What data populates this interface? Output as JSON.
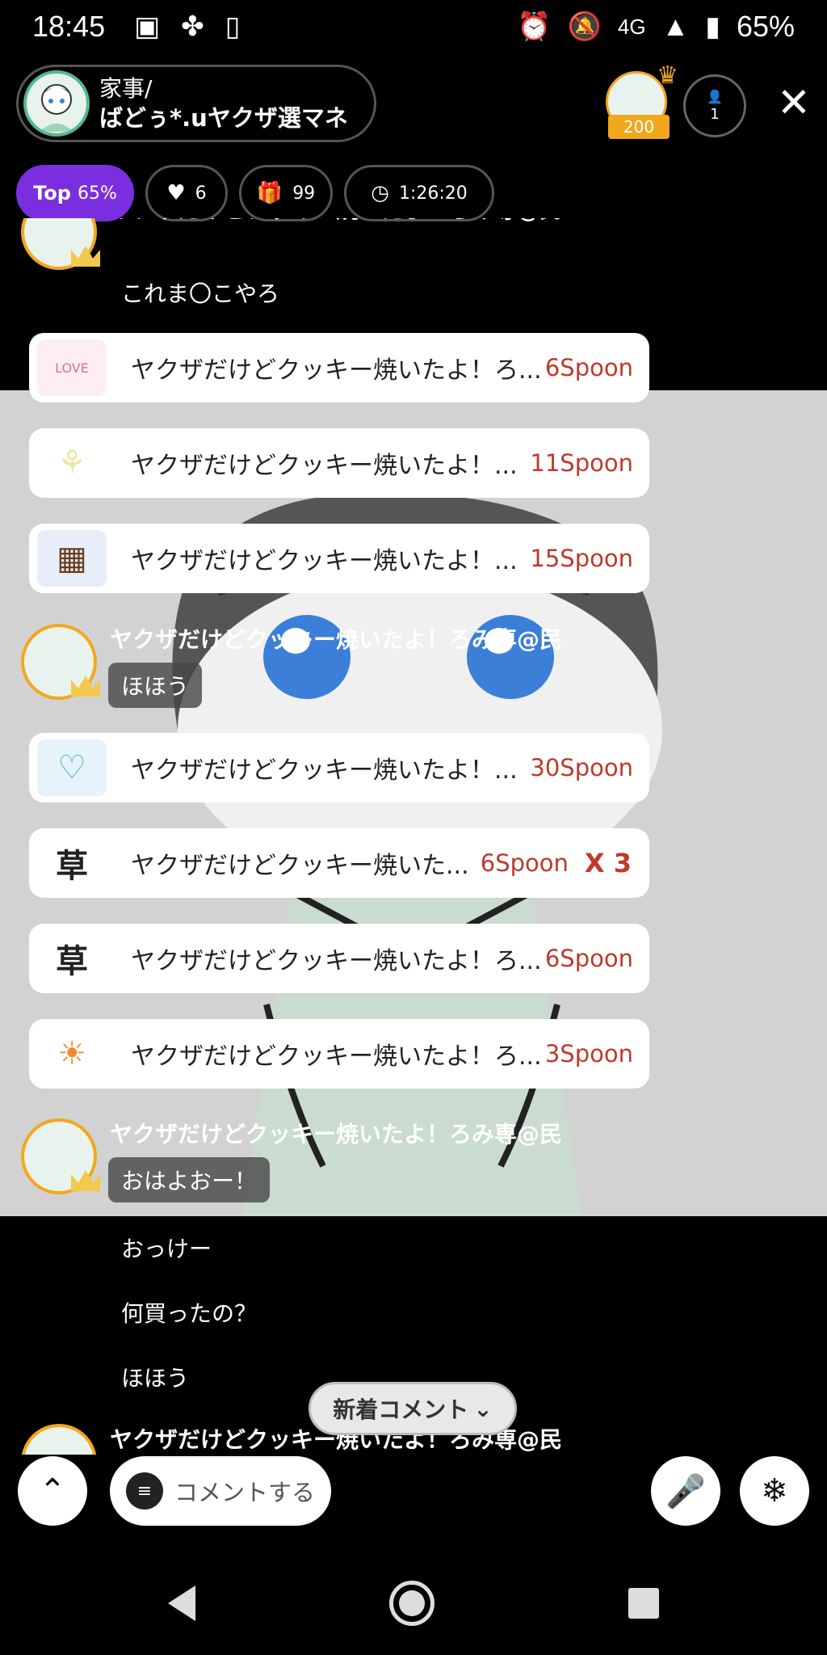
{
  "status_bar": {
    "time": "18:45",
    "network": "4G",
    "battery": "65%"
  },
  "header": {
    "title_line1": "家事/",
    "title_line2": "ばどぅ*.uヤクザ選マネ",
    "host_score": "200",
    "listener_count": "1"
  },
  "pills": {
    "top_label": "Top",
    "top_value": "65%",
    "likes": "6",
    "gifts": "99",
    "timer": "1:26:20"
  },
  "chat": {
    "top_partial_name": "ヤクザだけどクッキー焼いたよ！ろみ専@民",
    "top_partial_text": "これま〇こやろ",
    "gifts": [
      {
        "icon": "white-day-love-sticker",
        "text": "ヤクザだけどクッキー焼いたよ！ろ...",
        "amount": "6Spoon"
      },
      {
        "icon": "white-rose-sticker",
        "text": "ヤクザだけどクッキー焼いたよ！...",
        "amount": "11Spoon"
      },
      {
        "icon": "cookie-box-sticker",
        "text": "ヤクザだけどクッキー焼いたよ！...",
        "amount": "15Spoon"
      },
      {
        "icon": "honmei-heart-sticker",
        "text": "ヤクザだけどクッキー焼いたよ！...",
        "amount": "30Spoon"
      },
      {
        "icon": "kusa-sticker",
        "text": "ヤクザだけどクッキー焼いた...",
        "amount": "6Spoon",
        "multiplier": "X 3"
      },
      {
        "icon": "kusa-sticker",
        "text": "ヤクザだけどクッキー焼いたよ！ろ...",
        "amount": "6Spoon"
      },
      {
        "icon": "ohayou-sun-sticker",
        "text": "ヤクザだけどクッキー焼いたよ！ろ...",
        "amount": "3Spoon"
      }
    ],
    "user_messages": [
      {
        "name": "ヤクザだけどクッキー焼いたよ！ろみ専@民",
        "text": "ほほう"
      },
      {
        "name": "ヤクザだけどクッキー焼いたよ！ろみ専@民",
        "text": "おはよおー！"
      }
    ],
    "plain_lines": [
      "おっけー",
      "何買ったの？",
      "ほほう"
    ],
    "bottom_partial_name": "ヤクザだけどクッキー焼いたよ！ろみ専@民"
  },
  "new_comment_label": "新着コメント",
  "comment_placeholder": "コメントする",
  "colors": {
    "accent_purple": "#7a2ee0",
    "spoon_red": "#c0392b",
    "crown_gold": "#f2a81d"
  }
}
